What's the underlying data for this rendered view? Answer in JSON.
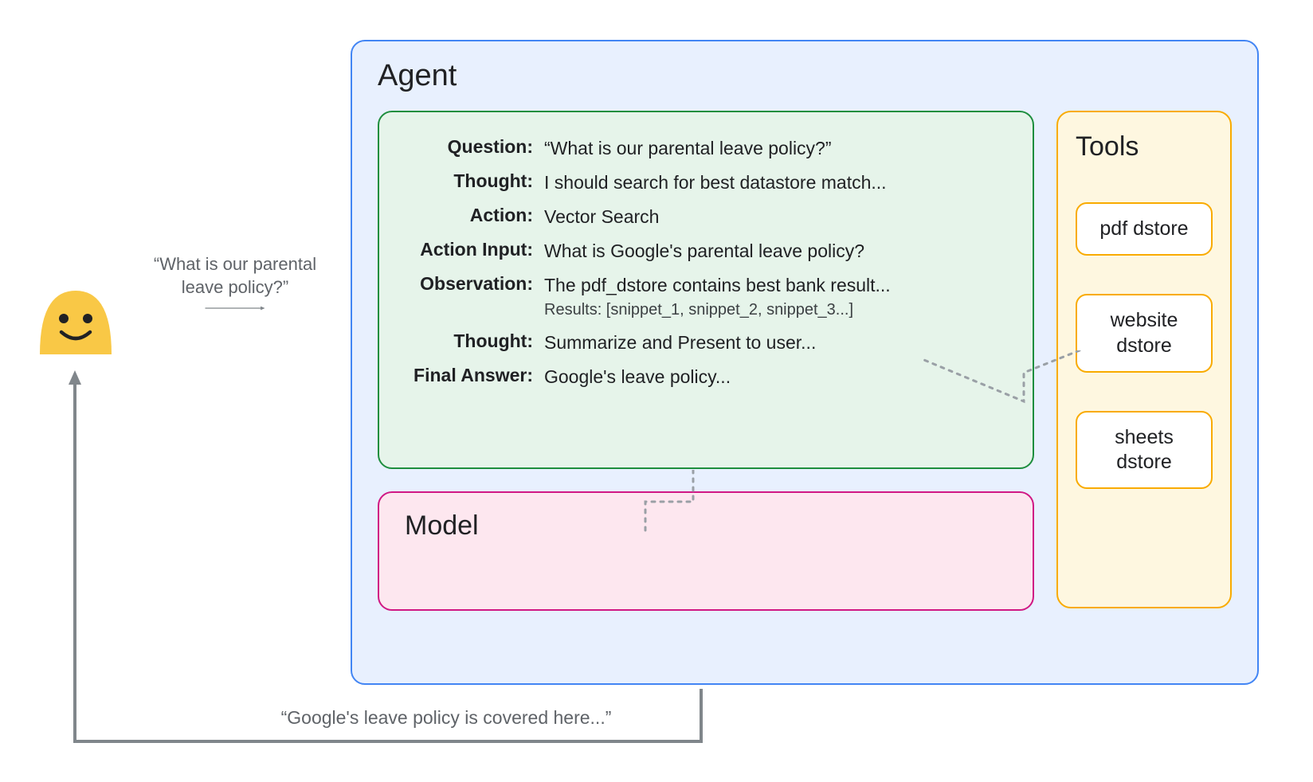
{
  "user_input": "“What is our parental leave policy?”",
  "agent": {
    "title": "Agent",
    "reasoning": [
      {
        "label": "Question:",
        "value": "“What is our parental leave policy?”",
        "sub": ""
      },
      {
        "label": "Thought:",
        "value": "I should search for best datastore match...",
        "sub": ""
      },
      {
        "label": "Action:",
        "value": "Vector Search",
        "sub": ""
      },
      {
        "label": "Action Input:",
        "value": "What is Google's parental leave policy?",
        "sub": ""
      },
      {
        "label": "Observation:",
        "value": "The pdf_dstore contains best bank result...",
        "sub": "Results: [snippet_1, snippet_2, snippet_3...]"
      },
      {
        "label": "Thought:",
        "value": "Summarize and Present to user...",
        "sub": ""
      },
      {
        "label": "Final Answer:",
        "value": "Google's leave policy...",
        "sub": ""
      }
    ],
    "model_title": "Model",
    "tools": {
      "title": "Tools",
      "items": [
        "pdf dstore",
        "website dstore",
        "sheets dstore"
      ]
    }
  },
  "return_text": "“Google's leave policy is covered here...”",
  "colors": {
    "agent_border": "#4285f4",
    "agent_bg": "#e8f0fe",
    "reasoning_border": "#1e8e3e",
    "reasoning_bg": "#e6f4ea",
    "model_border": "#d01884",
    "model_bg": "#fde7ef",
    "tools_border": "#f9ab00",
    "tools_bg": "#fef7e0",
    "arrow": "#80868b",
    "user_fill": "#f9c846"
  }
}
